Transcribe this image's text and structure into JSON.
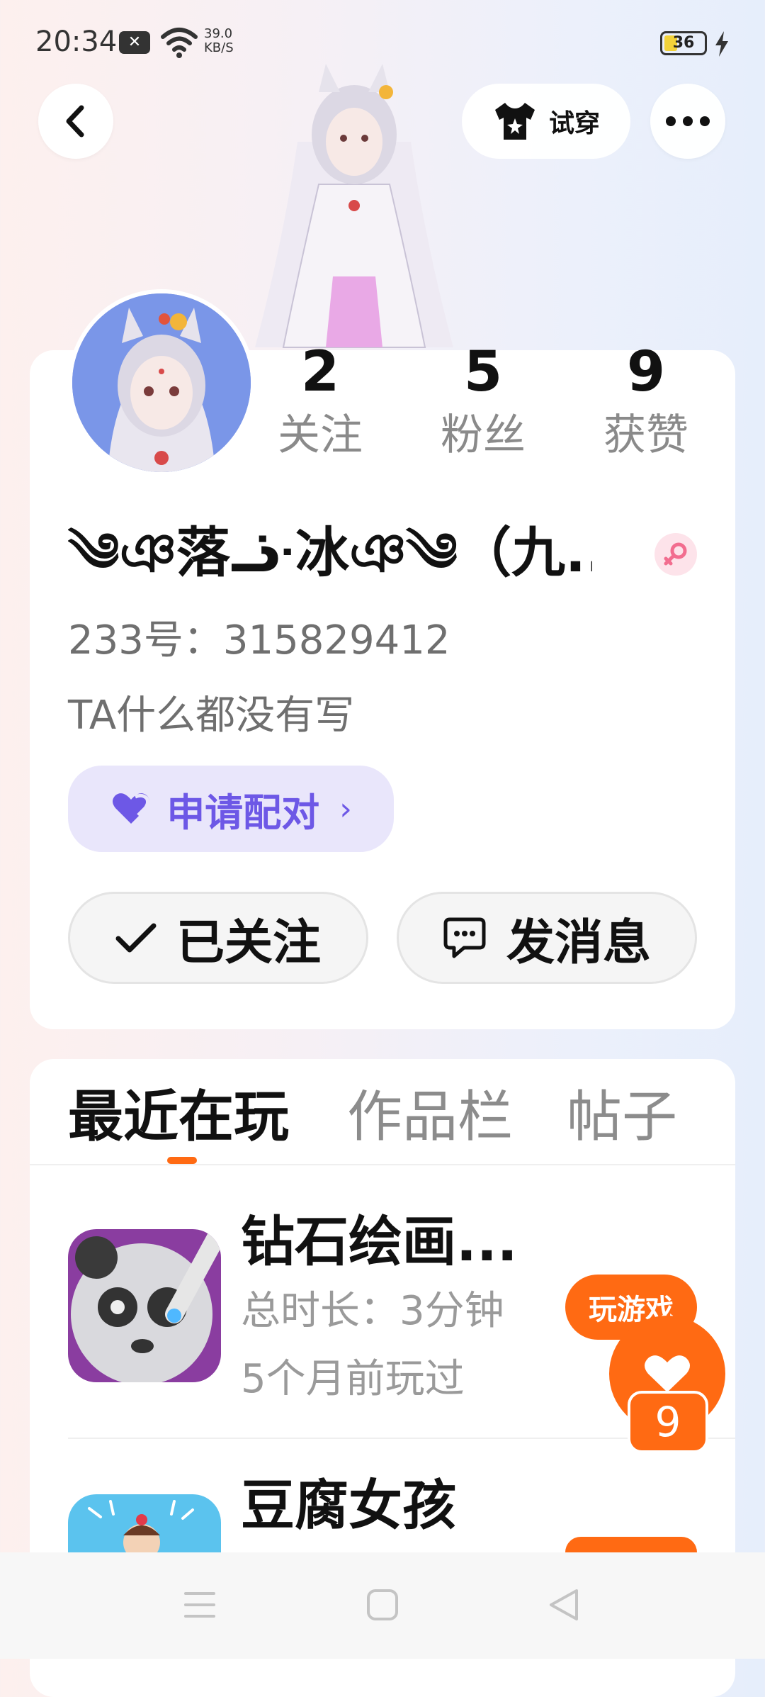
{
  "status_bar": {
    "time": "20:34",
    "notification_icon": "x-app-icon",
    "speed_value": "39.0",
    "speed_unit": "KB/S",
    "battery": "36"
  },
  "header": {
    "tryon_label": "试穿"
  },
  "profile": {
    "stats": [
      {
        "num": "2",
        "label": "关注"
      },
      {
        "num": "5",
        "label": "粉丝"
      },
      {
        "num": "9",
        "label": "获赞"
      }
    ],
    "nickname": "༄ঞ落ᓥ冰ঞ༄（九...",
    "uid": "233号：315829412",
    "bio": "TA什么都没有写",
    "pair_label": "申请配对",
    "follow_label": "已关注",
    "message_label": "发消息"
  },
  "tabs": [
    {
      "label": "最近在玩",
      "active": true
    },
    {
      "label": "作品栏",
      "active": false
    },
    {
      "label": "帖子",
      "active": false
    }
  ],
  "games": [
    {
      "title": "钻石绘画...",
      "duration": "总时长：3分钟",
      "last_played": "5个月前玩过",
      "button": "玩游戏"
    },
    {
      "title": "豆腐女孩",
      "duration": "",
      "last_played": "",
      "button": ""
    }
  ],
  "like": {
    "count": "9"
  },
  "colors": {
    "accent": "#ff6a13",
    "pair": "#6d58e6"
  }
}
